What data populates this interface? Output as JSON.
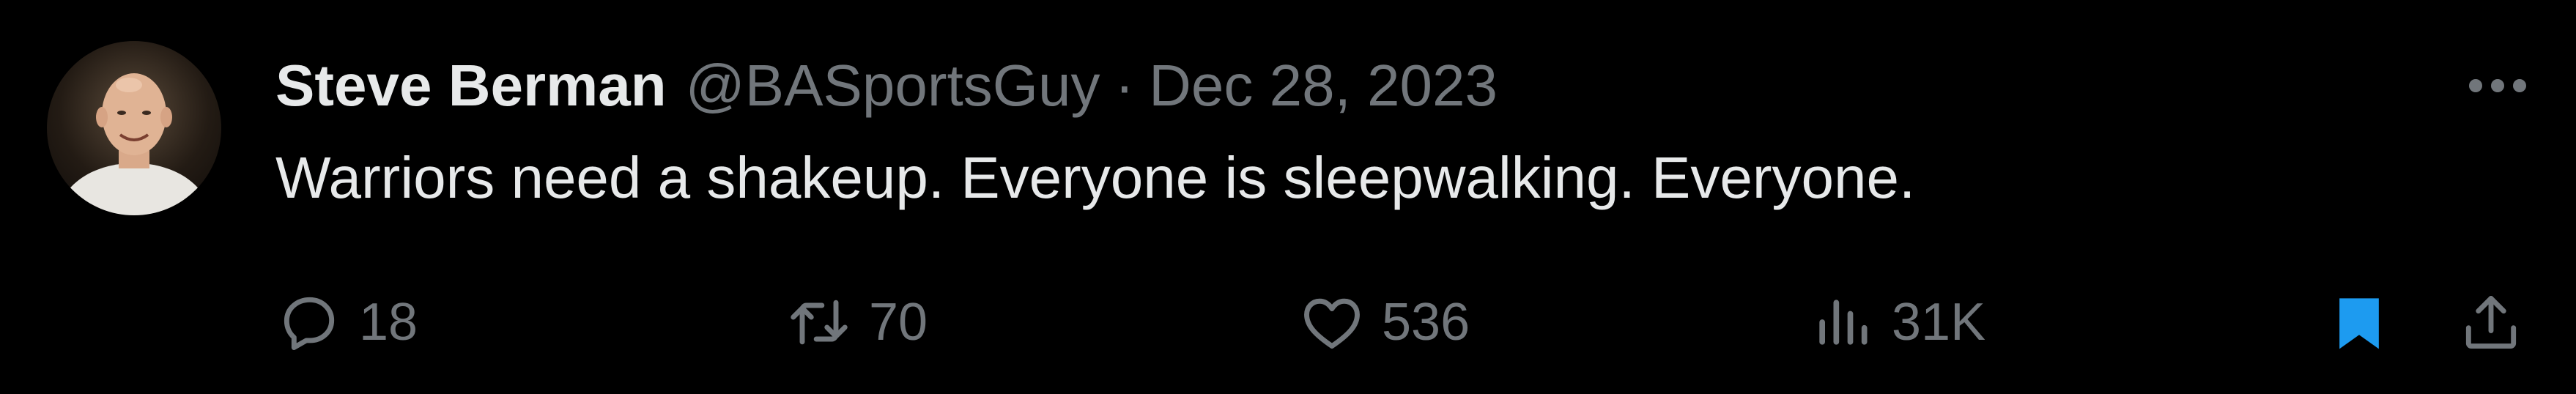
{
  "tweet": {
    "author_name": "Steve Berman",
    "author_handle": "@BASportsGuy",
    "separator": "·",
    "date": "Dec 28, 2023",
    "text": "Warriors need a shakeup. Everyone is sleepwalking. Everyone.",
    "more_icon": "more-horizontal-icon",
    "avatar_alt": "profile photo"
  },
  "actions": {
    "reply": {
      "icon": "reply-icon",
      "count": "18"
    },
    "repost": {
      "icon": "repost-icon",
      "count": "70"
    },
    "like": {
      "icon": "like-icon",
      "count": "536"
    },
    "views": {
      "icon": "views-icon",
      "count": "31K"
    },
    "bookmark": {
      "icon": "bookmark-icon",
      "active": true,
      "color": "#1d9bf0"
    },
    "share": {
      "icon": "share-icon"
    }
  },
  "colors": {
    "background": "#000000",
    "primary_text": "#e7e9ea",
    "secondary_text": "#71767b",
    "accent": "#1d9bf0"
  }
}
